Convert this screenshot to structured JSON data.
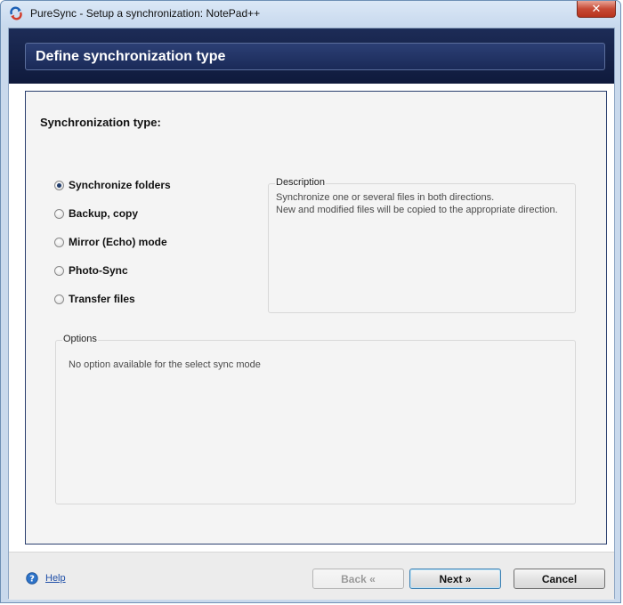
{
  "window": {
    "title": "PureSync - Setup a synchronization: NotePad++",
    "close_label": "✕"
  },
  "header": {
    "title": "Define synchronization type"
  },
  "sync_type": {
    "heading": "Synchronization type:",
    "selected": "Synchronize folders",
    "options": [
      {
        "label": "Synchronize folders",
        "checked": true
      },
      {
        "label": "Backup, copy",
        "checked": false
      },
      {
        "label": "Mirror (Echo) mode",
        "checked": false
      },
      {
        "label": "Photo-Sync",
        "checked": false
      },
      {
        "label": "Transfer files",
        "checked": false
      }
    ]
  },
  "description": {
    "legend": "Description",
    "line1": "Synchronize one or several files in both directions.",
    "line2": "New and modified files will be copied to the appropriate direction."
  },
  "options_box": {
    "legend": "Options",
    "text": "No option available for the select sync mode"
  },
  "footer": {
    "help_label": "Help",
    "back_label": "Back «",
    "next_label": "Next »",
    "cancel_label": "Cancel"
  },
  "icons": {
    "app": "puresync-sync-arrows-icon",
    "help": "help-question-icon"
  },
  "colors": {
    "header_band": "#1d2c57",
    "link": "#1f4fa8",
    "close_button": "#c74a35"
  }
}
